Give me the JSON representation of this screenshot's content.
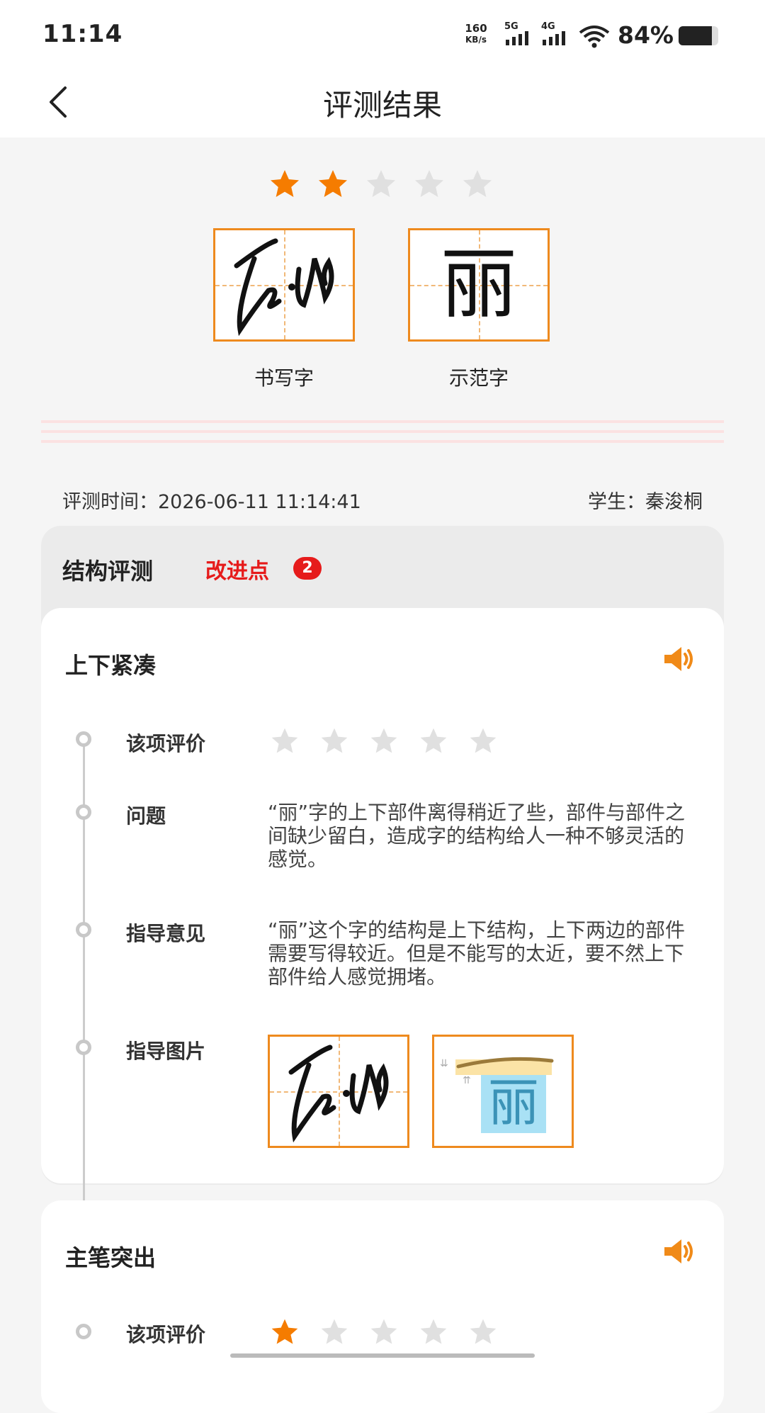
{
  "status_bar": {
    "time": "11:14",
    "net_speed_value": "160",
    "net_speed_unit": "KB/s",
    "sim1": "5G",
    "sim2": "4G",
    "battery": "84%"
  },
  "nav": {
    "title": "评测结果"
  },
  "overall_rating": {
    "score": 2,
    "max": 5
  },
  "chars": {
    "written_label": "书写字",
    "sample_label": "示范字",
    "sample_char": "丽"
  },
  "meta": {
    "time_label": "评测时间：2026-06-11 11:14:41",
    "student_label": "学生：秦浚桐"
  },
  "structure": {
    "title": "结构评测",
    "improve_label": "改进点",
    "improve_count": "2"
  },
  "items": [
    {
      "title": "上下紧凑",
      "rating_label": "该项评价",
      "rating": 0,
      "problem_label": "问题",
      "problem_text": "“丽”字的上下部件离得稍近了些，部件与部件之间缺少留白，造成字的结构给人一种不够灵活的感觉。",
      "advice_label": "指导意见",
      "advice_text": "“丽”这个字的结构是上下结构，上下两边的部件需要写得较近。但是不能写的太近，要不然上下部件给人感觉拥堵。",
      "image_label": "指导图片",
      "guide_char": "丽"
    },
    {
      "title": "主笔突出",
      "rating_label": "该项评价",
      "rating": 1
    }
  ],
  "colors": {
    "accent": "#ee8a1e",
    "star_on": "#f57c00",
    "star_off": "#e0e0e0",
    "alert": "#e61b1b"
  },
  "icons": [
    "back-arrow-icon",
    "star-icon",
    "speaker-icon",
    "wifi-icon",
    "battery-icon"
  ]
}
